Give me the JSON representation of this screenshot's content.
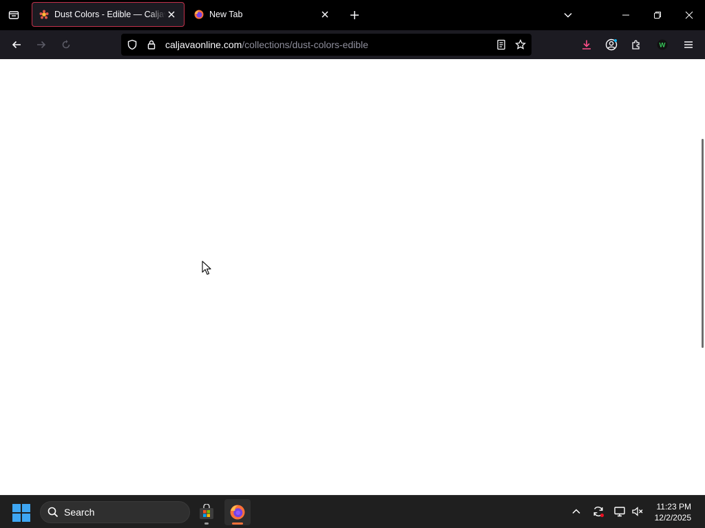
{
  "browser": {
    "tabs": [
      {
        "title": "Dust Colors - Edible — CaljavaOnline",
        "active": true
      },
      {
        "title": "New Tab",
        "active": false
      }
    ],
    "url": {
      "host": "caljavaonline.com",
      "path": "/collections/dust-colors-edible"
    },
    "colors": {
      "active_tab_border": "#c4314b",
      "download_icon": "#ff4f8a",
      "extension_badge": "#35c759"
    }
  },
  "page": {
    "background": "#ffffff"
  },
  "taskbar": {
    "search_label": "Search",
    "clock_time": "11:23 PM",
    "clock_date": "12/2/2025"
  }
}
